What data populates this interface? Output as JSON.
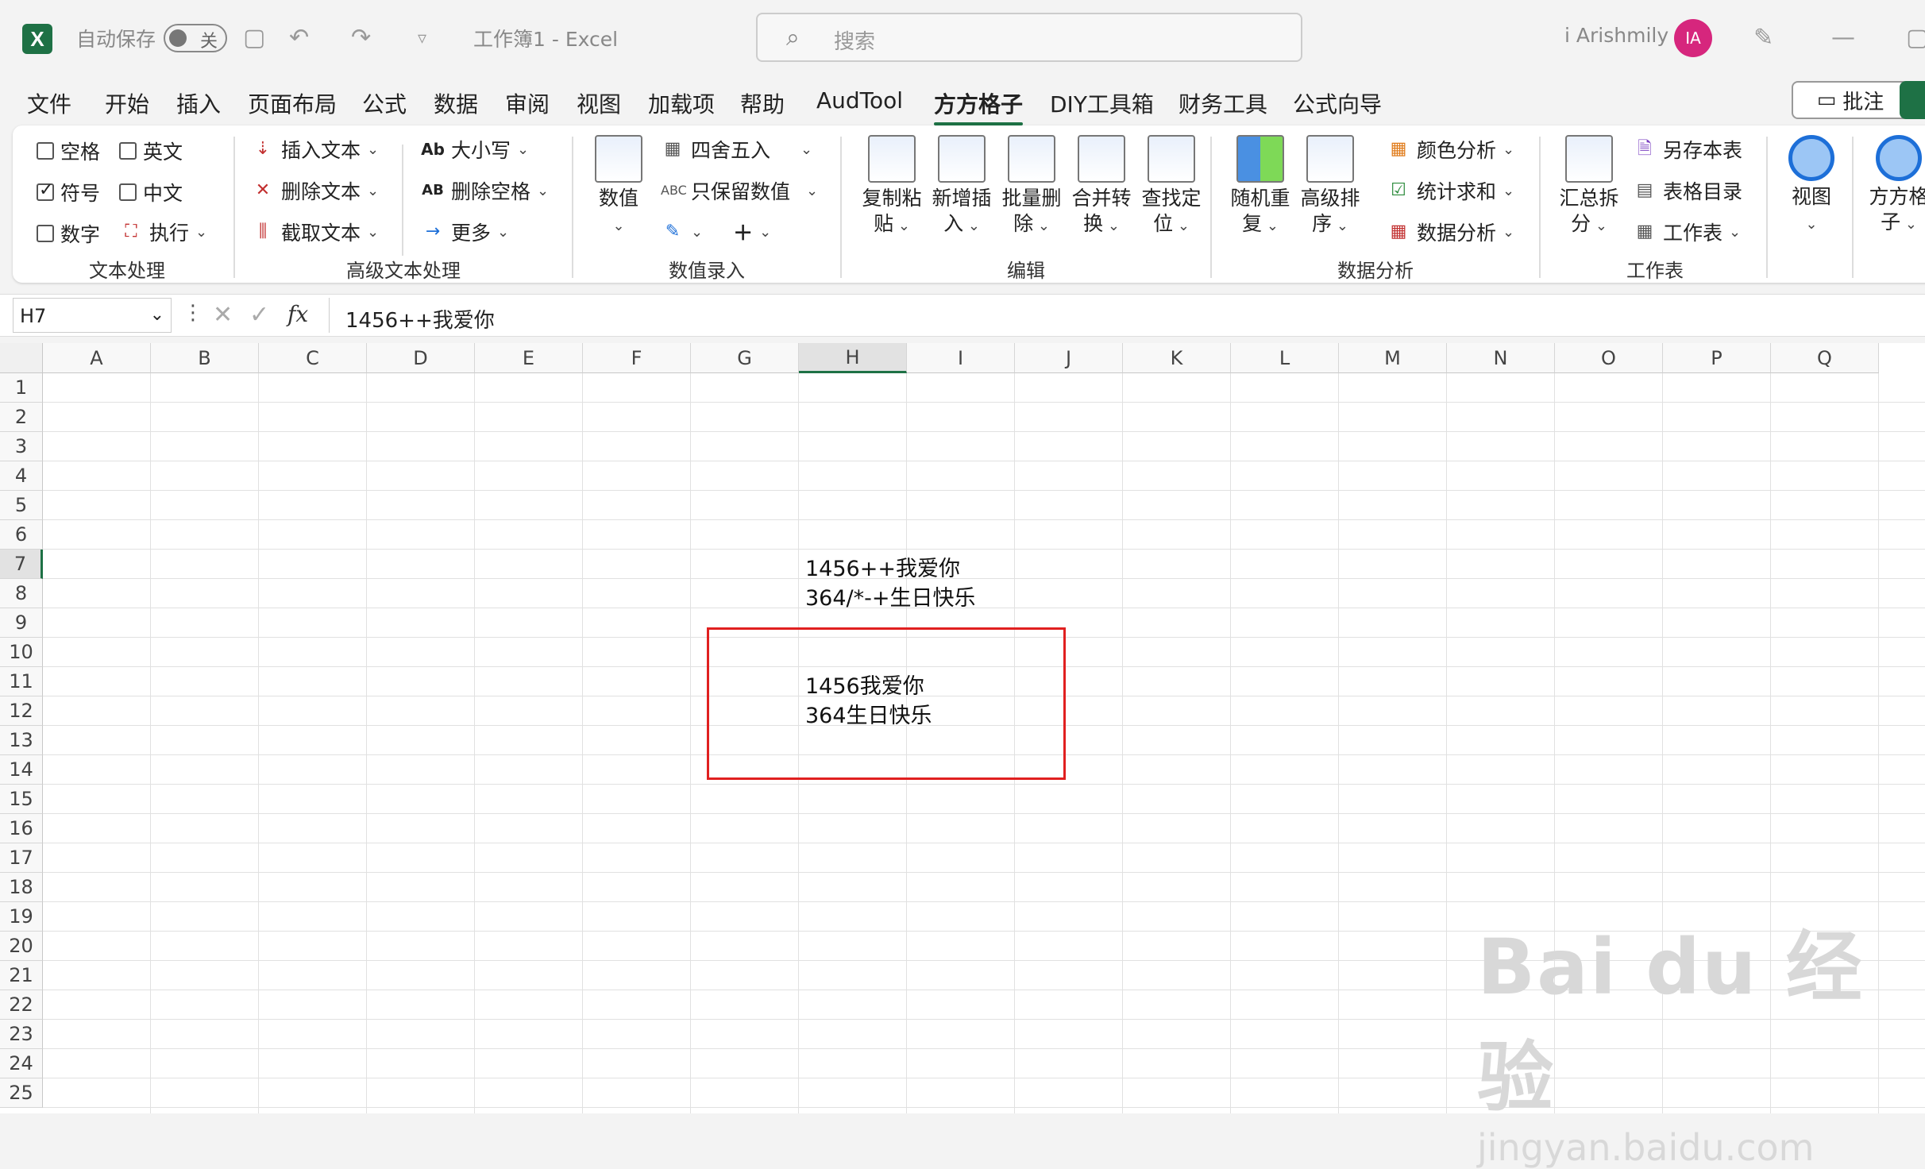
{
  "titlebar": {
    "logo": "X",
    "autosave_label": "自动保存",
    "autosave_state": "关",
    "doc_title": "工作簿1  -  Excel",
    "search_placeholder": "搜索",
    "user_name": "i Arishmily",
    "avatar_initials": "IA"
  },
  "menu": [
    "文件",
    "开始",
    "插入",
    "页面布局",
    "公式",
    "数据",
    "审阅",
    "视图",
    "加载项",
    "帮助",
    "AudTool",
    "方方格子",
    "DIY工具箱",
    "财务工具",
    "公式向导"
  ],
  "menu_active": "方方格子",
  "comment_button": "批注",
  "ribbon": {
    "text_group": {
      "label": "文本处理",
      "items": [
        "空格",
        "英文",
        "符号",
        "中文",
        "数字",
        "执行"
      ]
    },
    "adv_group": {
      "label": "高级文本处理",
      "items": [
        "插入文本",
        "删除文本",
        "截取文本",
        "大小写",
        "删除空格",
        "更多"
      ]
    },
    "num_group": {
      "label": "数值录入",
      "items": [
        "数值",
        "四舍五入",
        "只保留数值"
      ]
    },
    "edit_group": {
      "label": "编辑",
      "items": [
        [
          "复制粘",
          "贴"
        ],
        [
          "新增插",
          "入"
        ],
        [
          "批量删",
          "除"
        ],
        [
          "合并转",
          "换"
        ],
        [
          "查找定",
          "位"
        ]
      ]
    },
    "analysis_group": {
      "label": "数据分析",
      "items": [
        [
          "随机重",
          "复"
        ],
        [
          "高级排",
          "序"
        ]
      ],
      "small": [
        "颜色分析",
        "统计求和",
        "数据分析"
      ]
    },
    "sheet_group": {
      "label": "工作表",
      "items": [
        [
          "汇总拆",
          "分"
        ]
      ],
      "small": [
        "另存本表",
        "表格目录",
        "工作表"
      ]
    },
    "view": "视图",
    "ffgz": [
      "方方格",
      "子"
    ]
  },
  "formula_bar": {
    "name_box": "H7",
    "fx": "fx",
    "formula": "1456++我爱你"
  },
  "columns": [
    "A",
    "B",
    "C",
    "D",
    "E",
    "F",
    "G",
    "H",
    "I",
    "J",
    "K",
    "L",
    "M",
    "N",
    "O",
    "P",
    "Q"
  ],
  "rows": [
    "1",
    "2",
    "3",
    "4",
    "5",
    "6",
    "7",
    "8",
    "9",
    "10",
    "11",
    "12",
    "13",
    "14",
    "15",
    "16",
    "17",
    "18",
    "19",
    "20",
    "21",
    "22",
    "23",
    "24",
    "25"
  ],
  "cells": {
    "H7": "1456++我爱你",
    "H8": "364/*-+生日快乐",
    "H11": "1456我爱你",
    "H12": "364生日快乐"
  },
  "watermark": {
    "line1": "Bai du 经验",
    "line2": "jingyan.baidu.com"
  }
}
